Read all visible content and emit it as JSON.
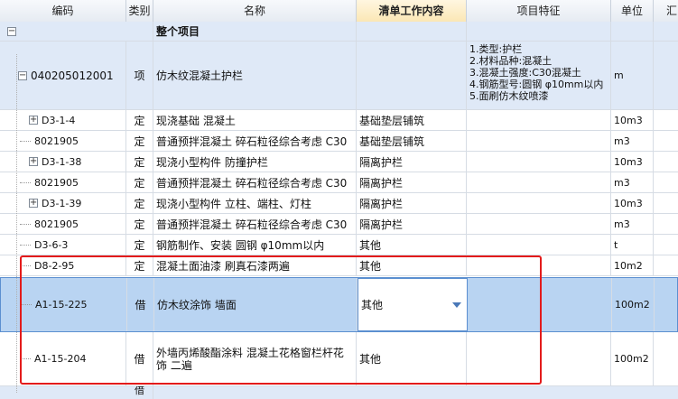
{
  "columns": [
    "编码",
    "类别",
    "名称",
    "清单工作内容",
    "项目特征",
    "单位",
    "汇"
  ],
  "active_column": "清单工作内容",
  "whole_project": {
    "code_toggle": "−",
    "label": "整个项目"
  },
  "item": {
    "toggle": "−",
    "code": "040205012001",
    "type": "项",
    "name": "仿木纹混凝土护栏",
    "features": [
      "1.类型:护栏",
      "2.材料品种:混凝土",
      "3.混凝土强度:C30混凝土",
      "4.钢筋型号:圆钢 φ10mm以内",
      "5.面刷仿木纹喷漆"
    ],
    "unit": "m"
  },
  "rows": [
    {
      "toggle": "+",
      "code": "D3-1-4",
      "type": "定",
      "name": "现浇基础 混凝土",
      "content": "基础垫层铺筑",
      "unit": "10m3"
    },
    {
      "toggle": "",
      "code": "8021905",
      "type": "定",
      "name": "普通预拌混凝土 碎石粒径综合考虑 C30",
      "content": "基础垫层铺筑",
      "unit": "m3"
    },
    {
      "toggle": "+",
      "code": "D3-1-38",
      "type": "定",
      "name": "现浇小型构件 防撞护栏",
      "content": "隔离护栏",
      "unit": "10m3"
    },
    {
      "toggle": "",
      "code": "8021905",
      "type": "定",
      "name": "普通预拌混凝土 碎石粒径综合考虑 C30",
      "content": "隔离护栏",
      "unit": "m3"
    },
    {
      "toggle": "+",
      "code": "D3-1-39",
      "type": "定",
      "name": "现浇小型构件 立柱、端柱、灯柱",
      "content": "隔离护栏",
      "unit": "10m3"
    },
    {
      "toggle": "",
      "code": "8021905",
      "type": "定",
      "name": "普通预拌混凝土 碎石粒径综合考虑 C30",
      "content": "隔离护栏",
      "unit": "m3"
    },
    {
      "toggle": "",
      "code": "D3-6-3",
      "type": "定",
      "name": "钢筋制作、安装 圆钢 φ10mm以内",
      "content": "其他",
      "unit": "t"
    },
    {
      "toggle": "",
      "code": "D8-2-95",
      "type": "定",
      "name": "混凝土面油漆 刷真石漆两遍",
      "content": "其他",
      "unit": "10m2"
    }
  ],
  "selected_row": {
    "code": "A1-15-225",
    "type": "借",
    "name": "仿木纹涂饰 墙面",
    "content": "其他",
    "unit": "100m2"
  },
  "last_row": {
    "code": "A1-15-204",
    "type": "借",
    "name": "外墙丙烯酸酯涂料 混凝土花格窗栏杆花饰 二遍",
    "content": "其他",
    "unit": "100m2"
  },
  "partial_row": {
    "type": "借"
  }
}
